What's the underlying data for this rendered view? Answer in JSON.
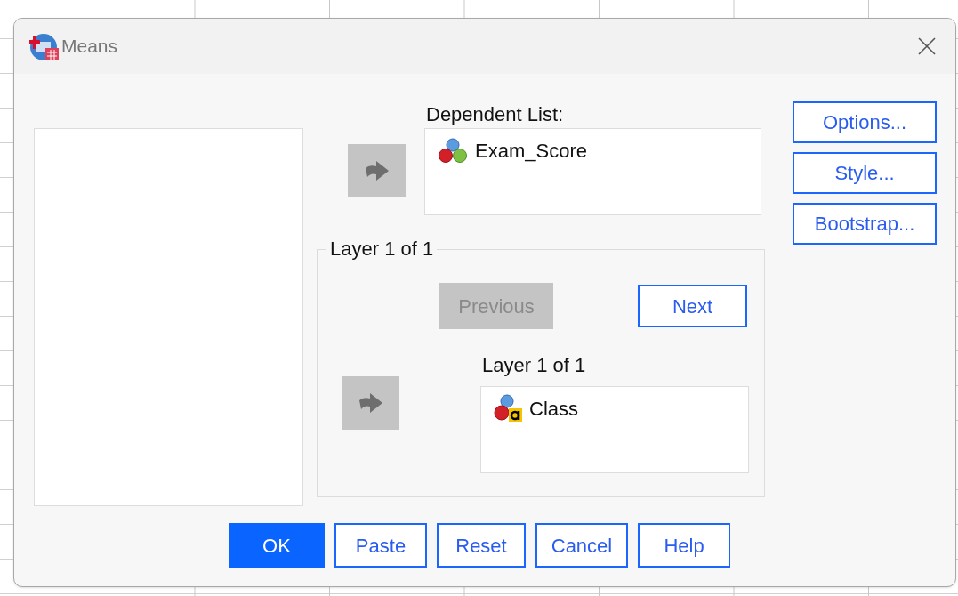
{
  "window": {
    "title": "Means"
  },
  "dependent": {
    "label": "Dependent List:",
    "move_disabled": true,
    "items": [
      {
        "name": "Exam_Score",
        "kind": "scale"
      }
    ]
  },
  "layer": {
    "title": "Layer 1 of 1",
    "previous": {
      "label": "Previous",
      "disabled": true
    },
    "next": {
      "label": "Next",
      "disabled": false
    },
    "list_label": "Layer 1 of 1",
    "move_disabled": true,
    "items": [
      {
        "name": "Class",
        "kind": "nominal"
      }
    ]
  },
  "side_buttons": [
    "Options...",
    "Style...",
    "Bootstrap..."
  ],
  "footer_buttons": [
    {
      "label": "OK",
      "default": true
    },
    {
      "label": "Paste",
      "default": false
    },
    {
      "label": "Reset",
      "default": false
    },
    {
      "label": "Cancel",
      "default": false
    },
    {
      "label": "Help",
      "default": false
    }
  ]
}
